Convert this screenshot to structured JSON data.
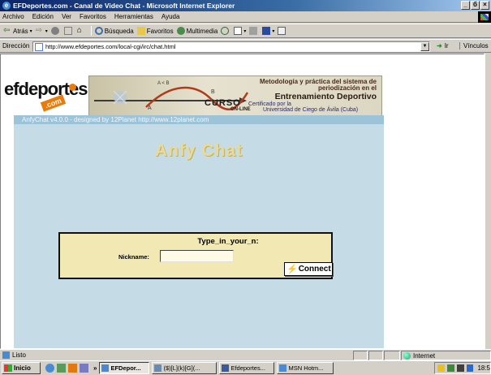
{
  "window": {
    "title": "EFDeportes.com - Canal de Video Chat - Microsoft Internet Explorer",
    "controls": [
      "_",
      "б",
      "×"
    ]
  },
  "menubar": {
    "items": [
      "Archivo",
      "Edición",
      "Ver",
      "Favoritos",
      "Herramientas",
      "Ayuda"
    ]
  },
  "toolbar": {
    "back": "Atrás",
    "search": "Búsqueda",
    "favorites": "Favoritos",
    "multimedia": "Multimedia"
  },
  "address": {
    "label": "Dirección",
    "url": "http://www.efdeportes.com/local-cgi/irc/chat.html",
    "go": "Ir",
    "links": "Vínculos"
  },
  "banner": {
    "logo_text": "efdeportes",
    "logo_suffix": ".com",
    "methodology": "Metodología y práctica del sistema de periodización en el",
    "training": "Entrenamiento Deportivo",
    "certified": "Certificado por la",
    "university": "Universidad de Ciego de Ávila (Cuba)",
    "course": "CURSO",
    "online": "ON-LINE",
    "graph_labels": [
      "A < B",
      "A",
      "B"
    ]
  },
  "applet": {
    "credits": "AnfyChat v4.0.0 - designed by 12Planet http://www.12planet.com",
    "title": "Anfy Chat",
    "prompt": "Type_in_your_n:",
    "nickname_label": "Nickname:",
    "nickname_value": "",
    "connect_label": "Connect"
  },
  "statusbar": {
    "text": "Listo",
    "zone": "Internet"
  },
  "taskbar": {
    "start": "Inicio",
    "overflow": "»",
    "tasks": [
      "EFDepor...",
      "($)[L](k)[G](...",
      "Efdeportes...",
      "MSN Hotm..."
    ],
    "clock": "18:5"
  },
  "colors": {
    "titlebar": "#0a246a",
    "applet_bg": "#c5dbe6",
    "login_bg": "#f1e8b4",
    "chat_title": "#e8da9a"
  }
}
